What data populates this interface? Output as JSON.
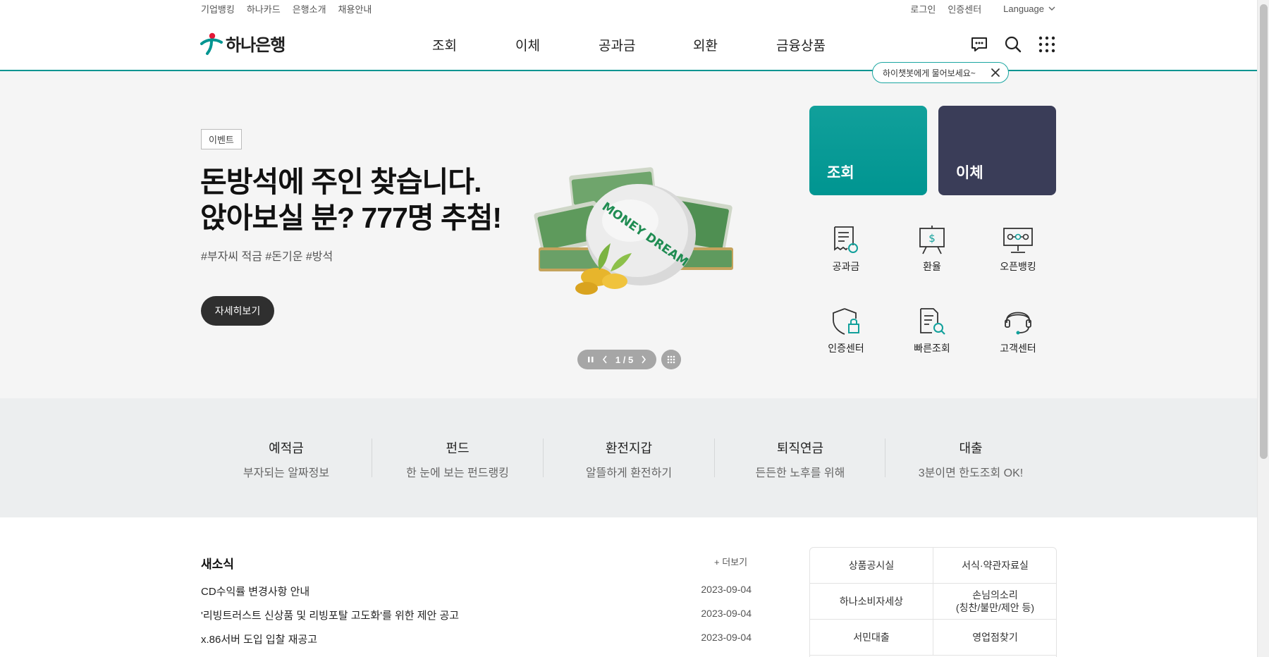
{
  "util": {
    "left": [
      "기업뱅킹",
      "하나카드",
      "은행소개",
      "채용안내"
    ],
    "right": [
      "로그인",
      "인증센터"
    ],
    "language": "Language"
  },
  "brand": {
    "name": "하나은행",
    "color": "#009591"
  },
  "menu": [
    "조회",
    "이체",
    "공과금",
    "외환",
    "금융상품"
  ],
  "chat_tip": "하이챗봇에게 물어보세요~",
  "hero": {
    "badge": "이벤트",
    "headline_1": "돈방석에 주인 찾습니다.",
    "headline_2": "앉아보실 분? 777명 추첨!",
    "tags": "#부자씨 적금 #돈기운 #방석",
    "more": "자세히보기",
    "pager": "1 / 5",
    "image_text": "MONEY DREAM"
  },
  "quick": {
    "card_view": "조회",
    "card_transfer": "이체",
    "items": [
      "공과금",
      "환율",
      "오픈뱅킹",
      "인증센터",
      "빠른조회",
      "고객센터"
    ]
  },
  "band": [
    {
      "title": "예적금",
      "sub": "부자되는 알짜정보"
    },
    {
      "title": "펀드",
      "sub": "한 눈에 보는 펀드랭킹"
    },
    {
      "title": "환전지갑",
      "sub": "알뜰하게 환전하기"
    },
    {
      "title": "퇴직연금",
      "sub": "든든한 노후를 위해"
    },
    {
      "title": "대출",
      "sub": "3분이면 한도조회 OK!"
    }
  ],
  "news": {
    "title": "새소식",
    "more": "+ 더보기",
    "rows": [
      {
        "text": "CD수익률 변경사항 안내",
        "date": "2023-09-04"
      },
      {
        "text": "'리빙트러스트 신상품 및 리빙포탈 고도화'를 위한 제안 공고",
        "date": "2023-09-04"
      },
      {
        "text": "x.86서버 도입 입찰 재공고",
        "date": "2023-09-04"
      }
    ]
  },
  "links": [
    "상품공시실",
    "서식·약관자료실",
    "하나소비자세상",
    "손님의소리",
    "(칭찬/불만/제안 등)",
    "서민대출",
    "영업점찾기"
  ]
}
